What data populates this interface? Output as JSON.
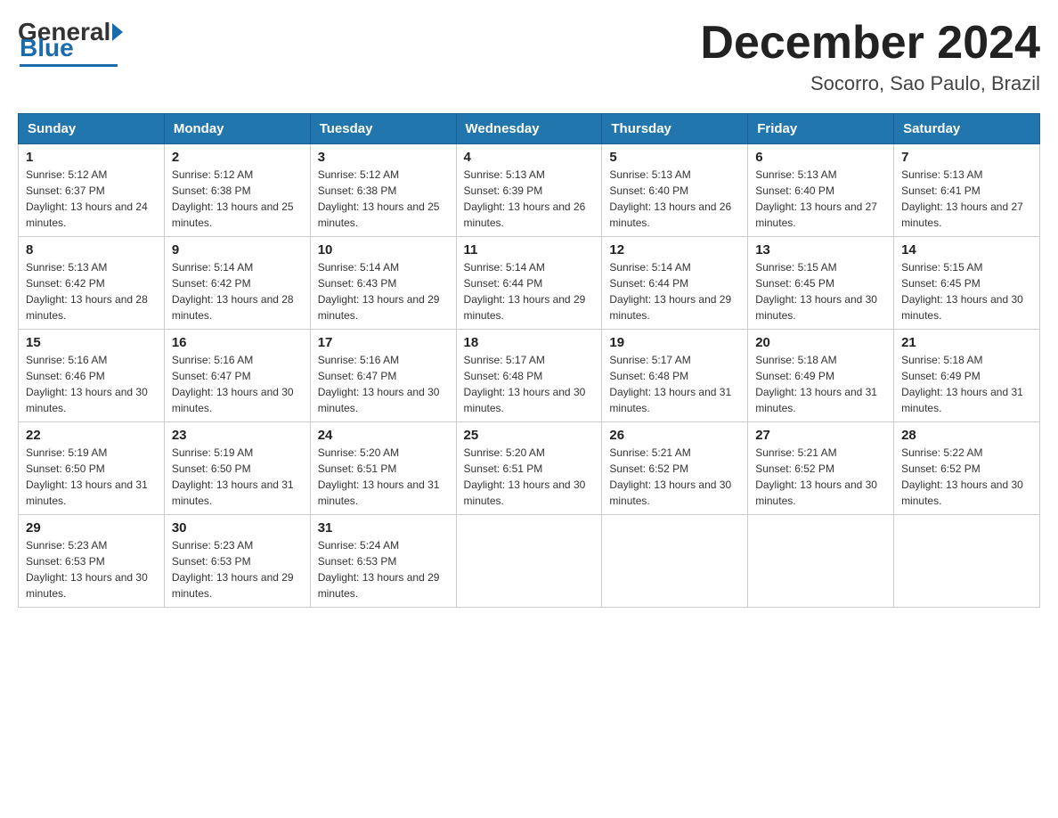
{
  "header": {
    "logo": {
      "general": "General",
      "blue": "Blue",
      "underline": "Blue"
    },
    "title": "December 2024",
    "subtitle": "Socorro, Sao Paulo, Brazil"
  },
  "columns": [
    "Sunday",
    "Monday",
    "Tuesday",
    "Wednesday",
    "Thursday",
    "Friday",
    "Saturday"
  ],
  "weeks": [
    [
      {
        "day": "1",
        "sunrise": "5:12 AM",
        "sunset": "6:37 PM",
        "daylight": "13 hours and 24 minutes."
      },
      {
        "day": "2",
        "sunrise": "5:12 AM",
        "sunset": "6:38 PM",
        "daylight": "13 hours and 25 minutes."
      },
      {
        "day": "3",
        "sunrise": "5:12 AM",
        "sunset": "6:38 PM",
        "daylight": "13 hours and 25 minutes."
      },
      {
        "day": "4",
        "sunrise": "5:13 AM",
        "sunset": "6:39 PM",
        "daylight": "13 hours and 26 minutes."
      },
      {
        "day": "5",
        "sunrise": "5:13 AM",
        "sunset": "6:40 PM",
        "daylight": "13 hours and 26 minutes."
      },
      {
        "day": "6",
        "sunrise": "5:13 AM",
        "sunset": "6:40 PM",
        "daylight": "13 hours and 27 minutes."
      },
      {
        "day": "7",
        "sunrise": "5:13 AM",
        "sunset": "6:41 PM",
        "daylight": "13 hours and 27 minutes."
      }
    ],
    [
      {
        "day": "8",
        "sunrise": "5:13 AM",
        "sunset": "6:42 PM",
        "daylight": "13 hours and 28 minutes."
      },
      {
        "day": "9",
        "sunrise": "5:14 AM",
        "sunset": "6:42 PM",
        "daylight": "13 hours and 28 minutes."
      },
      {
        "day": "10",
        "sunrise": "5:14 AM",
        "sunset": "6:43 PM",
        "daylight": "13 hours and 29 minutes."
      },
      {
        "day": "11",
        "sunrise": "5:14 AM",
        "sunset": "6:44 PM",
        "daylight": "13 hours and 29 minutes."
      },
      {
        "day": "12",
        "sunrise": "5:14 AM",
        "sunset": "6:44 PM",
        "daylight": "13 hours and 29 minutes."
      },
      {
        "day": "13",
        "sunrise": "5:15 AM",
        "sunset": "6:45 PM",
        "daylight": "13 hours and 30 minutes."
      },
      {
        "day": "14",
        "sunrise": "5:15 AM",
        "sunset": "6:45 PM",
        "daylight": "13 hours and 30 minutes."
      }
    ],
    [
      {
        "day": "15",
        "sunrise": "5:16 AM",
        "sunset": "6:46 PM",
        "daylight": "13 hours and 30 minutes."
      },
      {
        "day": "16",
        "sunrise": "5:16 AM",
        "sunset": "6:47 PM",
        "daylight": "13 hours and 30 minutes."
      },
      {
        "day": "17",
        "sunrise": "5:16 AM",
        "sunset": "6:47 PM",
        "daylight": "13 hours and 30 minutes."
      },
      {
        "day": "18",
        "sunrise": "5:17 AM",
        "sunset": "6:48 PM",
        "daylight": "13 hours and 30 minutes."
      },
      {
        "day": "19",
        "sunrise": "5:17 AM",
        "sunset": "6:48 PM",
        "daylight": "13 hours and 31 minutes."
      },
      {
        "day": "20",
        "sunrise": "5:18 AM",
        "sunset": "6:49 PM",
        "daylight": "13 hours and 31 minutes."
      },
      {
        "day": "21",
        "sunrise": "5:18 AM",
        "sunset": "6:49 PM",
        "daylight": "13 hours and 31 minutes."
      }
    ],
    [
      {
        "day": "22",
        "sunrise": "5:19 AM",
        "sunset": "6:50 PM",
        "daylight": "13 hours and 31 minutes."
      },
      {
        "day": "23",
        "sunrise": "5:19 AM",
        "sunset": "6:50 PM",
        "daylight": "13 hours and 31 minutes."
      },
      {
        "day": "24",
        "sunrise": "5:20 AM",
        "sunset": "6:51 PM",
        "daylight": "13 hours and 31 minutes."
      },
      {
        "day": "25",
        "sunrise": "5:20 AM",
        "sunset": "6:51 PM",
        "daylight": "13 hours and 30 minutes."
      },
      {
        "day": "26",
        "sunrise": "5:21 AM",
        "sunset": "6:52 PM",
        "daylight": "13 hours and 30 minutes."
      },
      {
        "day": "27",
        "sunrise": "5:21 AM",
        "sunset": "6:52 PM",
        "daylight": "13 hours and 30 minutes."
      },
      {
        "day": "28",
        "sunrise": "5:22 AM",
        "sunset": "6:52 PM",
        "daylight": "13 hours and 30 minutes."
      }
    ],
    [
      {
        "day": "29",
        "sunrise": "5:23 AM",
        "sunset": "6:53 PM",
        "daylight": "13 hours and 30 minutes."
      },
      {
        "day": "30",
        "sunrise": "5:23 AM",
        "sunset": "6:53 PM",
        "daylight": "13 hours and 29 minutes."
      },
      {
        "day": "31",
        "sunrise": "5:24 AM",
        "sunset": "6:53 PM",
        "daylight": "13 hours and 29 minutes."
      },
      null,
      null,
      null,
      null
    ]
  ]
}
